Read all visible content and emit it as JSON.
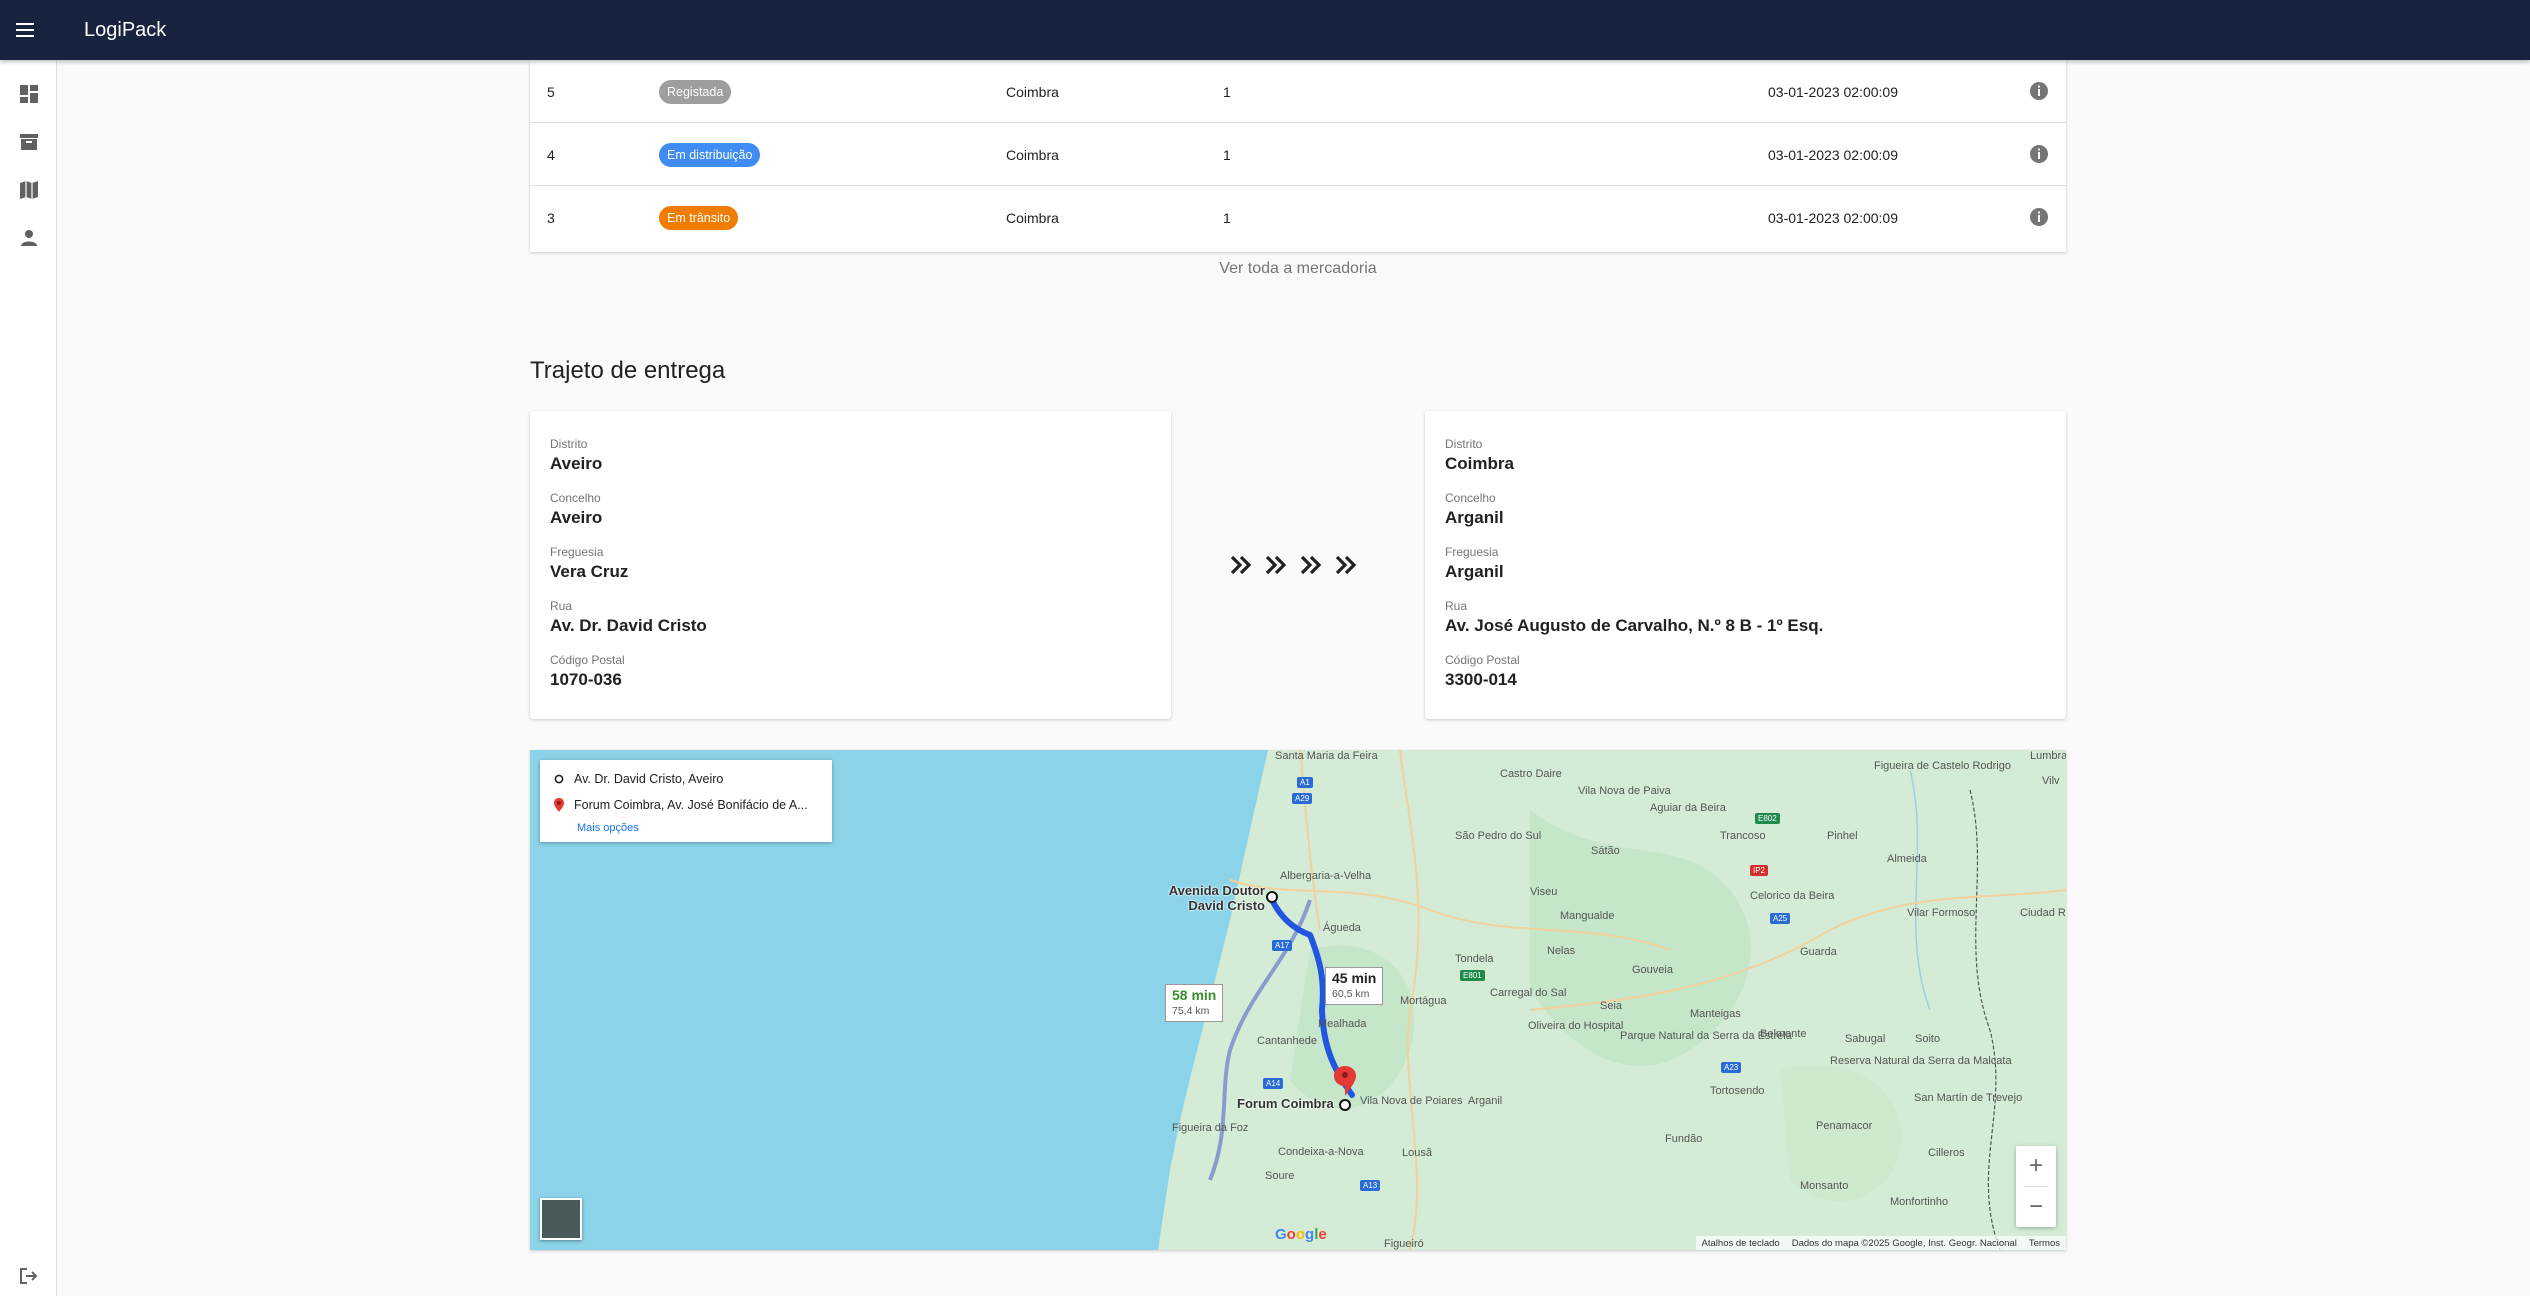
{
  "app": {
    "title": "LogiPack"
  },
  "sidebar": {
    "items": [
      {
        "icon": "dashboard-icon"
      },
      {
        "icon": "archive-icon"
      },
      {
        "icon": "map-icon"
      },
      {
        "icon": "person-icon"
      }
    ],
    "logout_icon": "logout-icon"
  },
  "shipments": {
    "rows": [
      {
        "id": "5",
        "status": "Registada",
        "status_color": "#9e9e9e",
        "city": "Coimbra",
        "qty": "1",
        "date": "03-01-2023 02:00:09"
      },
      {
        "id": "4",
        "status": "Em distribuição",
        "status_color": "#3f8cf3",
        "city": "Coimbra",
        "qty": "1",
        "date": "03-01-2023 02:00:09"
      },
      {
        "id": "3",
        "status": "Em trânsito",
        "status_color": "#f07c00",
        "city": "Coimbra",
        "qty": "1",
        "date": "03-01-2023 02:00:09"
      }
    ],
    "see_all": "Ver toda a mercadoria"
  },
  "route": {
    "title": "Trajeto de entrega",
    "origin": {
      "district_label": "Distrito",
      "district": "Aveiro",
      "municipality_label": "Concelho",
      "municipality": "Aveiro",
      "parish_label": "Freguesia",
      "parish": "Vera Cruz",
      "street_label": "Rua",
      "street": "Av. Dr. David Cristo",
      "postal_label": "Código Postal",
      "postal": "1070-036"
    },
    "destination": {
      "district_label": "Distrito",
      "district": "Coimbra",
      "municipality_label": "Concelho",
      "municipality": "Arganil",
      "parish_label": "Freguesia",
      "parish": "Arganil",
      "street_label": "Rua",
      "street": "Av. José Augusto de Carvalho, N.º 8 B - 1º Esq.",
      "postal_label": "Código Postal",
      "postal": "3300-014"
    }
  },
  "map": {
    "from": "Av. Dr. David Cristo, Aveiro",
    "to": "Forum Coimbra, Av. José Bonifácio de A...",
    "more_options": "Mais opções",
    "main_route": {
      "duration": "45 min",
      "distance": "60,5 km"
    },
    "alt_route": {
      "duration": "58 min",
      "distance": "75,4 km"
    },
    "places": {
      "santa_maria": "Santa Maria da Feira",
      "castro_daire": "Castro Daire",
      "vila_nova_paiva": "Vila Nova de Paiva",
      "aguiar_beira": "Aguiar da Beira",
      "trancoso": "Trancoso",
      "figueira_castelo": "Figueira de Castelo Rodrigo",
      "lumbrales": "Lumbrales",
      "vilvestre": "Vilv",
      "sao_pedro_sul": "São Pedro do Sul",
      "satao": "Sátão",
      "pinhel": "Pinhel",
      "almeida": "Almeida",
      "albergaria": "Albergaria-a-Velha",
      "viseu": "Viseu",
      "celorico": "Celorico da Beira",
      "vilar_formoso": "Vilar Formoso",
      "cidade_rodrigo": "Ciudad Rodrigo",
      "avenida": "Avenida Doutor David Cristo",
      "agueda": "Águeda",
      "mangualde": "Mangualde",
      "guarda": "Guarda",
      "tondela": "Tondela",
      "nelas": "Nelas",
      "gouveia": "Gouveia",
      "carregal": "Carregal do Sal",
      "mortagua": "Mortágua",
      "seia": "Seia",
      "mealhada": "Mealhada",
      "oliveira_hospital": "Oliveira do Hospital",
      "manteigas": "Manteigas",
      "belmonte": "Belmonte",
      "parque": "Parque Natural da Serra da Estrela",
      "sabugal": "Sabugal",
      "reserva": "Reserva Natural da Serra da Malcata",
      "cantanhede": "Cantanhede",
      "forum": "Forum Coimbra",
      "vila_nova_poiares": "Vila Nova de Poiares",
      "arganil": "Arganil",
      "tortosendo": "Tortosendo",
      "soito": "Soito",
      "san_martin": "San Martín de Trevejo",
      "penamacor": "Penamacor",
      "figueira_foz": "Figueira da Foz",
      "condeixa": "Condeixa-a-Nova",
      "lousa": "Lousã",
      "fundao": "Fundão",
      "cilleros": "Cilleros",
      "soure": "Soure",
      "monsanto": "Monsanto",
      "monfortinho": "Monfortinho",
      "figueiro": "Figueiró"
    },
    "roads": [
      "A1",
      "A29",
      "A17",
      "A25",
      "E801",
      "E802",
      "IP2",
      "A23",
      "A14",
      "A13"
    ],
    "google": "Google",
    "attribution": {
      "shortcuts": "Atalhos de teclado",
      "data": "Dados do mapa ©2025 Google, Inst. Geogr. Nacional",
      "terms": "Termos"
    },
    "zoom_in": "+",
    "zoom_out": "−"
  }
}
